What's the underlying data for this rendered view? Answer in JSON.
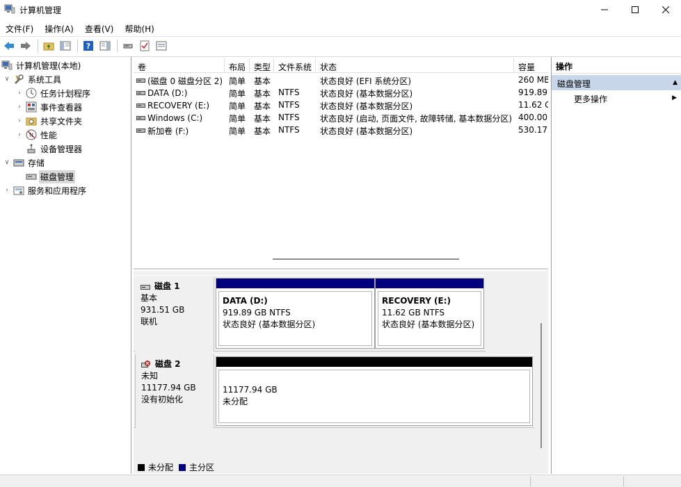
{
  "window": {
    "title": "计算机管理"
  },
  "menu": [
    "文件(F)",
    "操作(A)",
    "查看(V)",
    "帮助(H)"
  ],
  "toolbar": [
    "back-icon",
    "forward-icon",
    "up-folder-icon",
    "show-hide-tree-icon",
    "help-icon",
    "show-hide-action-icon",
    "connect-icon",
    "check-icon",
    "properties-icon"
  ],
  "tree": {
    "root": "计算机管理(本地)",
    "system_tools": "系统工具",
    "task_scheduler": "任务计划程序",
    "event_viewer": "事件查看器",
    "shared_folders": "共享文件夹",
    "performance": "性能",
    "device_manager": "设备管理器",
    "storage": "存储",
    "disk_management": "磁盘管理",
    "services_apps": "服务和应用程序"
  },
  "volumes": {
    "columns": [
      "卷",
      "布局",
      "类型",
      "文件系统",
      "状态",
      "容量"
    ],
    "rows": [
      [
        "(磁盘 0 磁盘分区 2)",
        "简单",
        "基本",
        "",
        "状态良好 (EFI 系统分区)",
        "260 MB"
      ],
      [
        "DATA (D:)",
        "简单",
        "基本",
        "NTFS",
        "状态良好 (基本数据分区)",
        "919.89"
      ],
      [
        "RECOVERY (E:)",
        "简单",
        "基本",
        "NTFS",
        "状态良好 (基本数据分区)",
        "11.62 G"
      ],
      [
        "Windows (C:)",
        "简单",
        "基本",
        "NTFS",
        "状态良好 (启动, 页面文件, 故障转储, 基本数据分区)",
        "400.00"
      ],
      [
        "新加卷 (F:)",
        "简单",
        "基本",
        "NTFS",
        "状态良好 (基本数据分区)",
        "530.17"
      ]
    ]
  },
  "disks": {
    "disk1": {
      "name": "磁盘 1",
      "type": "基本",
      "size": "931.51 GB",
      "state": "联机",
      "partitions": [
        {
          "name": "DATA  (D:)",
          "size": "919.89 GB NTFS",
          "status": "状态良好 (基本数据分区)"
        },
        {
          "name": "RECOVERY  (E:)",
          "size": "11.62 GB NTFS",
          "status": "状态良好 (基本数据分区)"
        }
      ]
    },
    "disk2": {
      "name": "磁盘 2",
      "type": "未知",
      "size": "11177.94 GB",
      "state": "没有初始化",
      "partition": {
        "size": "11177.94 GB",
        "status": "未分配"
      }
    }
  },
  "legend": {
    "unallocated": "未分配",
    "primary": "主分区"
  },
  "actions": {
    "header": "操作",
    "section": "磁盘管理",
    "more": "更多操作"
  },
  "colors": {
    "primary_partition": "#00007f",
    "unallocated": "#000000",
    "selection": "#c7d6e8"
  }
}
